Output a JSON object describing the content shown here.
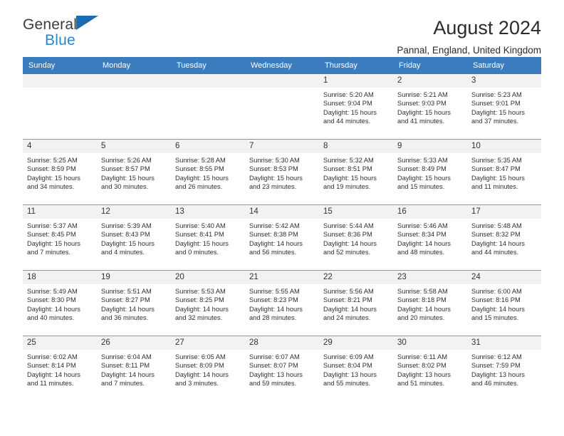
{
  "brand": {
    "name_top": "General",
    "name_bottom": "Blue",
    "flag_icon": "triangle-flag-icon",
    "accent_color": "#1b6cb0",
    "accent_color_light": "#2287d4"
  },
  "header": {
    "title": "August 2024",
    "subtitle": "Pannal, England, United Kingdom"
  },
  "calendar": {
    "header_bg": "#3a7cbe",
    "daynum_bg": "#f2f2f2",
    "row_border": "#6f9fce",
    "weekday_headers": [
      "Sunday",
      "Monday",
      "Tuesday",
      "Wednesday",
      "Thursday",
      "Friday",
      "Saturday"
    ],
    "weeks": [
      [
        {
          "day": "",
          "empty": true,
          "sunrise": "",
          "sunset": "",
          "daylight_line1": "",
          "daylight_line2": ""
        },
        {
          "day": "",
          "empty": true,
          "sunrise": "",
          "sunset": "",
          "daylight_line1": "",
          "daylight_line2": ""
        },
        {
          "day": "",
          "empty": true,
          "sunrise": "",
          "sunset": "",
          "daylight_line1": "",
          "daylight_line2": ""
        },
        {
          "day": "",
          "empty": true,
          "sunrise": "",
          "sunset": "",
          "daylight_line1": "",
          "daylight_line2": ""
        },
        {
          "day": "1",
          "empty": false,
          "sunrise": "Sunrise: 5:20 AM",
          "sunset": "Sunset: 9:04 PM",
          "daylight_line1": "Daylight: 15 hours",
          "daylight_line2": "and 44 minutes."
        },
        {
          "day": "2",
          "empty": false,
          "sunrise": "Sunrise: 5:21 AM",
          "sunset": "Sunset: 9:03 PM",
          "daylight_line1": "Daylight: 15 hours",
          "daylight_line2": "and 41 minutes."
        },
        {
          "day": "3",
          "empty": false,
          "sunrise": "Sunrise: 5:23 AM",
          "sunset": "Sunset: 9:01 PM",
          "daylight_line1": "Daylight: 15 hours",
          "daylight_line2": "and 37 minutes."
        }
      ],
      [
        {
          "day": "4",
          "empty": false,
          "sunrise": "Sunrise: 5:25 AM",
          "sunset": "Sunset: 8:59 PM",
          "daylight_line1": "Daylight: 15 hours",
          "daylight_line2": "and 34 minutes."
        },
        {
          "day": "5",
          "empty": false,
          "sunrise": "Sunrise: 5:26 AM",
          "sunset": "Sunset: 8:57 PM",
          "daylight_line1": "Daylight: 15 hours",
          "daylight_line2": "and 30 minutes."
        },
        {
          "day": "6",
          "empty": false,
          "sunrise": "Sunrise: 5:28 AM",
          "sunset": "Sunset: 8:55 PM",
          "daylight_line1": "Daylight: 15 hours",
          "daylight_line2": "and 26 minutes."
        },
        {
          "day": "7",
          "empty": false,
          "sunrise": "Sunrise: 5:30 AM",
          "sunset": "Sunset: 8:53 PM",
          "daylight_line1": "Daylight: 15 hours",
          "daylight_line2": "and 23 minutes."
        },
        {
          "day": "8",
          "empty": false,
          "sunrise": "Sunrise: 5:32 AM",
          "sunset": "Sunset: 8:51 PM",
          "daylight_line1": "Daylight: 15 hours",
          "daylight_line2": "and 19 minutes."
        },
        {
          "day": "9",
          "empty": false,
          "sunrise": "Sunrise: 5:33 AM",
          "sunset": "Sunset: 8:49 PM",
          "daylight_line1": "Daylight: 15 hours",
          "daylight_line2": "and 15 minutes."
        },
        {
          "day": "10",
          "empty": false,
          "sunrise": "Sunrise: 5:35 AM",
          "sunset": "Sunset: 8:47 PM",
          "daylight_line1": "Daylight: 15 hours",
          "daylight_line2": "and 11 minutes."
        }
      ],
      [
        {
          "day": "11",
          "empty": false,
          "sunrise": "Sunrise: 5:37 AM",
          "sunset": "Sunset: 8:45 PM",
          "daylight_line1": "Daylight: 15 hours",
          "daylight_line2": "and 7 minutes."
        },
        {
          "day": "12",
          "empty": false,
          "sunrise": "Sunrise: 5:39 AM",
          "sunset": "Sunset: 8:43 PM",
          "daylight_line1": "Daylight: 15 hours",
          "daylight_line2": "and 4 minutes."
        },
        {
          "day": "13",
          "empty": false,
          "sunrise": "Sunrise: 5:40 AM",
          "sunset": "Sunset: 8:41 PM",
          "daylight_line1": "Daylight: 15 hours",
          "daylight_line2": "and 0 minutes."
        },
        {
          "day": "14",
          "empty": false,
          "sunrise": "Sunrise: 5:42 AM",
          "sunset": "Sunset: 8:38 PM",
          "daylight_line1": "Daylight: 14 hours",
          "daylight_line2": "and 56 minutes."
        },
        {
          "day": "15",
          "empty": false,
          "sunrise": "Sunrise: 5:44 AM",
          "sunset": "Sunset: 8:36 PM",
          "daylight_line1": "Daylight: 14 hours",
          "daylight_line2": "and 52 minutes."
        },
        {
          "day": "16",
          "empty": false,
          "sunrise": "Sunrise: 5:46 AM",
          "sunset": "Sunset: 8:34 PM",
          "daylight_line1": "Daylight: 14 hours",
          "daylight_line2": "and 48 minutes."
        },
        {
          "day": "17",
          "empty": false,
          "sunrise": "Sunrise: 5:48 AM",
          "sunset": "Sunset: 8:32 PM",
          "daylight_line1": "Daylight: 14 hours",
          "daylight_line2": "and 44 minutes."
        }
      ],
      [
        {
          "day": "18",
          "empty": false,
          "sunrise": "Sunrise: 5:49 AM",
          "sunset": "Sunset: 8:30 PM",
          "daylight_line1": "Daylight: 14 hours",
          "daylight_line2": "and 40 minutes."
        },
        {
          "day": "19",
          "empty": false,
          "sunrise": "Sunrise: 5:51 AM",
          "sunset": "Sunset: 8:27 PM",
          "daylight_line1": "Daylight: 14 hours",
          "daylight_line2": "and 36 minutes."
        },
        {
          "day": "20",
          "empty": false,
          "sunrise": "Sunrise: 5:53 AM",
          "sunset": "Sunset: 8:25 PM",
          "daylight_line1": "Daylight: 14 hours",
          "daylight_line2": "and 32 minutes."
        },
        {
          "day": "21",
          "empty": false,
          "sunrise": "Sunrise: 5:55 AM",
          "sunset": "Sunset: 8:23 PM",
          "daylight_line1": "Daylight: 14 hours",
          "daylight_line2": "and 28 minutes."
        },
        {
          "day": "22",
          "empty": false,
          "sunrise": "Sunrise: 5:56 AM",
          "sunset": "Sunset: 8:21 PM",
          "daylight_line1": "Daylight: 14 hours",
          "daylight_line2": "and 24 minutes."
        },
        {
          "day": "23",
          "empty": false,
          "sunrise": "Sunrise: 5:58 AM",
          "sunset": "Sunset: 8:18 PM",
          "daylight_line1": "Daylight: 14 hours",
          "daylight_line2": "and 20 minutes."
        },
        {
          "day": "24",
          "empty": false,
          "sunrise": "Sunrise: 6:00 AM",
          "sunset": "Sunset: 8:16 PM",
          "daylight_line1": "Daylight: 14 hours",
          "daylight_line2": "and 15 minutes."
        }
      ],
      [
        {
          "day": "25",
          "empty": false,
          "sunrise": "Sunrise: 6:02 AM",
          "sunset": "Sunset: 8:14 PM",
          "daylight_line1": "Daylight: 14 hours",
          "daylight_line2": "and 11 minutes."
        },
        {
          "day": "26",
          "empty": false,
          "sunrise": "Sunrise: 6:04 AM",
          "sunset": "Sunset: 8:11 PM",
          "daylight_line1": "Daylight: 14 hours",
          "daylight_line2": "and 7 minutes."
        },
        {
          "day": "27",
          "empty": false,
          "sunrise": "Sunrise: 6:05 AM",
          "sunset": "Sunset: 8:09 PM",
          "daylight_line1": "Daylight: 14 hours",
          "daylight_line2": "and 3 minutes."
        },
        {
          "day": "28",
          "empty": false,
          "sunrise": "Sunrise: 6:07 AM",
          "sunset": "Sunset: 8:07 PM",
          "daylight_line1": "Daylight: 13 hours",
          "daylight_line2": "and 59 minutes."
        },
        {
          "day": "29",
          "empty": false,
          "sunrise": "Sunrise: 6:09 AM",
          "sunset": "Sunset: 8:04 PM",
          "daylight_line1": "Daylight: 13 hours",
          "daylight_line2": "and 55 minutes."
        },
        {
          "day": "30",
          "empty": false,
          "sunrise": "Sunrise: 6:11 AM",
          "sunset": "Sunset: 8:02 PM",
          "daylight_line1": "Daylight: 13 hours",
          "daylight_line2": "and 51 minutes."
        },
        {
          "day": "31",
          "empty": false,
          "sunrise": "Sunrise: 6:12 AM",
          "sunset": "Sunset: 7:59 PM",
          "daylight_line1": "Daylight: 13 hours",
          "daylight_line2": "and 46 minutes."
        }
      ]
    ]
  }
}
